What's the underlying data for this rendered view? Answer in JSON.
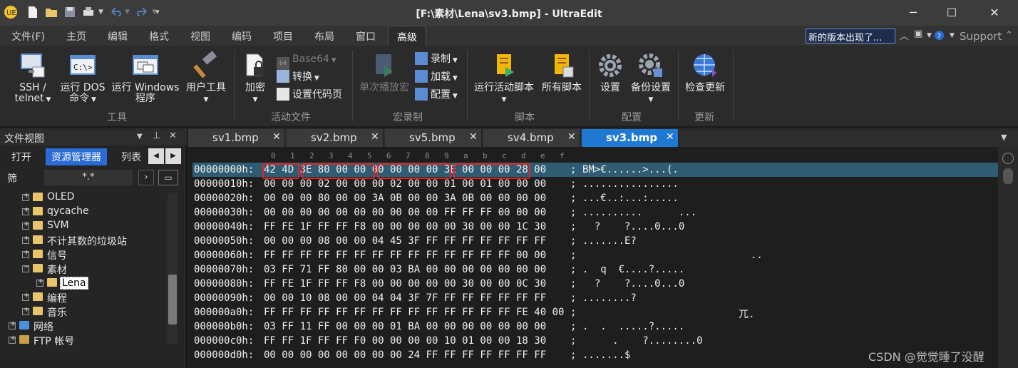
{
  "window": {
    "title": "[F:\\素材\\Lena\\sv3.bmp] - UltraEdit",
    "minimize": "─",
    "maximize": "☐",
    "close": "✕"
  },
  "menu": {
    "tabs": [
      "文件(F)",
      "主页",
      "编辑",
      "格式",
      "视图",
      "编码",
      "项目",
      "布局",
      "窗口",
      "高级"
    ],
    "active": "高级",
    "notice": "新的版本出现了...",
    "support": "Support"
  },
  "ribbon": {
    "ssh": {
      "line1": "SSH /",
      "line2": "telnet"
    },
    "dos": {
      "line1": "运行 DOS",
      "line2": "命令"
    },
    "windows": {
      "line1": "运行 Windows",
      "line2": "程序"
    },
    "tools": "用户工具",
    "group_tools": "工具",
    "encrypt": "加密",
    "base64": "Base64",
    "convert": "转换",
    "codepage": "设置代码页",
    "group_active": "活动文件",
    "play_once": "单次播放宏",
    "record": "录制",
    "load": "加载",
    "config": "配置",
    "group_macro": "宏录制",
    "run_script": "运行活动脚本",
    "all_scripts": "所有脚本",
    "group_script": "脚本",
    "settings": "设置",
    "backup": "备份设置",
    "group_config": "配置",
    "check_update": "检查更新",
    "group_update": "更新"
  },
  "left_pane": {
    "title": "文件视图",
    "pin": "📌",
    "close": "✕",
    "tabs": [
      "打开",
      "资源管理器",
      "列表"
    ],
    "active_tab": "资源管理器",
    "filter_label": "筛",
    "filter_value": "*.*",
    "tree": [
      {
        "label": "OLED",
        "indent": 1,
        "exp": "+"
      },
      {
        "label": "qycache",
        "indent": 1,
        "exp": "+"
      },
      {
        "label": "SVM",
        "indent": 1,
        "exp": "+"
      },
      {
        "label": "不计其数的垃圾站",
        "indent": 1,
        "exp": "+"
      },
      {
        "label": "信号",
        "indent": 1,
        "exp": "+"
      },
      {
        "label": "素材",
        "indent": 1,
        "exp": "−"
      },
      {
        "label": "Lena",
        "indent": 2,
        "exp": "+",
        "selected": true
      },
      {
        "label": "编程",
        "indent": 1,
        "exp": "+"
      },
      {
        "label": "音乐",
        "indent": 1,
        "exp": "+"
      },
      {
        "label": "网络",
        "indent": 0,
        "exp": "+"
      },
      {
        "label": "FTP 帐号",
        "indent": 0,
        "exp": "+"
      }
    ]
  },
  "editor_tabs": [
    "sv1.bmp",
    "sv2.bmp",
    "sv5.bmp",
    "sv4.bmp",
    "sv3.bmp"
  ],
  "active_editor_tab": "sv3.bmp",
  "hex": {
    "columns": [
      "0",
      "1",
      "2",
      "3",
      "4",
      "5",
      "6",
      "7",
      "8",
      "9",
      "a",
      "b",
      "c",
      "d",
      "e",
      "f"
    ],
    "rows": [
      {
        "addr": "00000000h:",
        "bytes": "42 4D 3E 80 00 00 00 00 00 00 3E 00 00 00 28 00",
        "ascii": "BM>€......>...(.",
        "sel": true
      },
      {
        "addr": "00000010h:",
        "bytes": "00 00 00 02 00 00 00 02 00 00 01 00 01 00 00 00",
        "ascii": "................"
      },
      {
        "addr": "00000020h:",
        "bytes": "00 00 00 80 00 00 3A 0B 00 00 3A 0B 00 00 00 00",
        "ascii": "...€..:...:....."
      },
      {
        "addr": "00000030h:",
        "bytes": "00 00 00 00 00 00 00 00 00 00 FF FF FF 00 00 00",
        "ascii": "..........      ..."
      },
      {
        "addr": "00000040h:",
        "bytes": "FF FE 1F FF FF F8 00 00 00 00 00 30 00 00 1C 30",
        "ascii": "  ?    ?....0...0"
      },
      {
        "addr": "00000050h:",
        "bytes": "00 00 00 08 00 00 04 45 3F FF FF FF FF FF FF FF",
        "ascii": ".......E?"
      },
      {
        "addr": "00000060h:",
        "bytes": "FF FF FF FF FF FF FF FF FF FF FF FF FF FF 00 00",
        "ascii": "                            .."
      },
      {
        "addr": "00000070h:",
        "bytes": "03 FF 71 FF 80 00 00 03 BA 00 00 00 00 00 00 00",
        "ascii": ".  q  €....?....."
      },
      {
        "addr": "00000080h:",
        "bytes": "FF FE 1F FF FF F8 00 00 00 00 00 30 00 00 0C 30",
        "ascii": "  ?    ?....0...0"
      },
      {
        "addr": "00000090h:",
        "bytes": "00 00 10 08 00 00 04 04 3F 7F FF FF FF FF FF FF",
        "ascii": "........?"
      },
      {
        "addr": "000000a0h:",
        "bytes": "FF FF FF FF FF FF FF FF FF FF FF FF FF FF FE 40 00",
        "ascii": "                          兀."
      },
      {
        "addr": "000000b0h:",
        "bytes": "03 FF 11 FF 00 00 00 01 BA 00 00 00 00 00 00 00",
        "ascii": ".  .  .....?....."
      },
      {
        "addr": "000000c0h:",
        "bytes": "FF FF 1F FF FF F0 00 00 00 00 10 01 00 00 18 30",
        "ascii": "     .    ?........0"
      },
      {
        "addr": "000000d0h:",
        "bytes": "00 00 00 00 00 00 00 00 24 FF FF FF FF FF FF FF",
        "ascii": ".......$"
      }
    ]
  },
  "watermark": "CSDN @觉觉睡了没醒",
  "colors": {
    "accent": "#1f78d1",
    "highlight_box": "#e52424",
    "selected_row": "#2f5c73"
  }
}
